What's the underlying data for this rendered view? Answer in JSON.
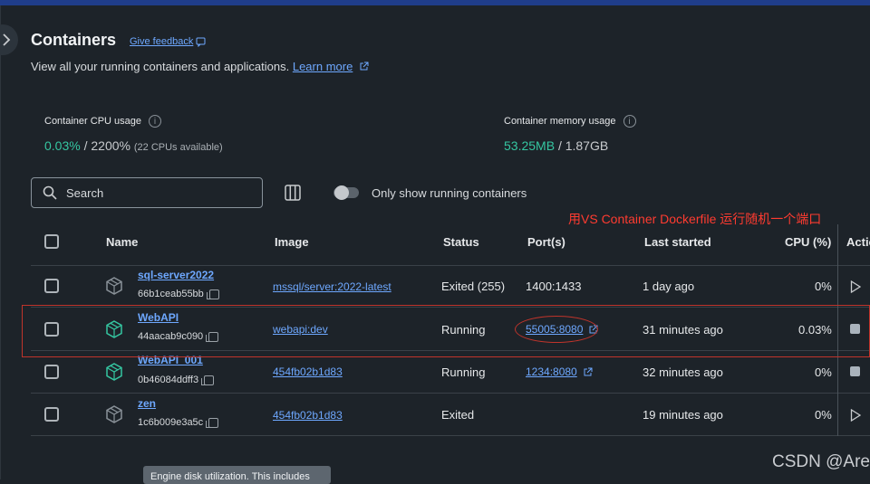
{
  "header": {
    "title": "Containers",
    "feedback": "Give feedback",
    "subtitle": "View all your running containers and applications.",
    "learn_more": "Learn more"
  },
  "stats": {
    "cpu_label": "Container CPU usage",
    "cpu_value": "0.03%",
    "cpu_total": "/ 2200%",
    "cpu_note": "(22 CPUs available)",
    "mem_label": "Container memory usage",
    "mem_value": "53.25MB",
    "mem_total": "/ 1.87GB"
  },
  "toolbar": {
    "search_placeholder": "Search",
    "toggle_label": "Only show running containers",
    "toggle_on": false
  },
  "annotation": "用VS Container Dockerfile 运行随机一个端口",
  "table": {
    "headers": [
      "Name",
      "Image",
      "Status",
      "Port(s)",
      "Last started",
      "CPU (%)",
      "Actio"
    ],
    "rows": [
      {
        "name": "sql-server2022",
        "id": "66b1ceab55bb",
        "image": "mssql/server:2022-latest",
        "status": "Exited (255)",
        "port": "1400:1433",
        "last_started": "1 day ago",
        "cpu": "0%",
        "running": false
      },
      {
        "name": "WebAPI",
        "id": "44aacab9c090",
        "image": "webapi:dev",
        "status": "Running",
        "port": "55005:8080",
        "last_started": "31 minutes ago",
        "cpu": "0.03%",
        "running": true
      },
      {
        "name": "WebAPI_001",
        "id": "0b46084ddff3",
        "image": "454fb02b1d83",
        "status": "Running",
        "port": "1234:8080",
        "last_started": "32 minutes ago",
        "cpu": "0%",
        "running": true
      },
      {
        "name": "zen",
        "id": "1c6b009e3a5c",
        "image": "454fb02b1d83",
        "status": "Exited",
        "port": "",
        "last_started": "19 minutes ago",
        "cpu": "0%",
        "running": false
      }
    ]
  },
  "tooltip": "Engine disk utilization. This includes",
  "watermark": "CSDN @Are",
  "colors": {
    "accent": "#6ea8ff",
    "green": "#35c6a1",
    "annotation": "#ff3b30",
    "background": "#1d2329"
  }
}
